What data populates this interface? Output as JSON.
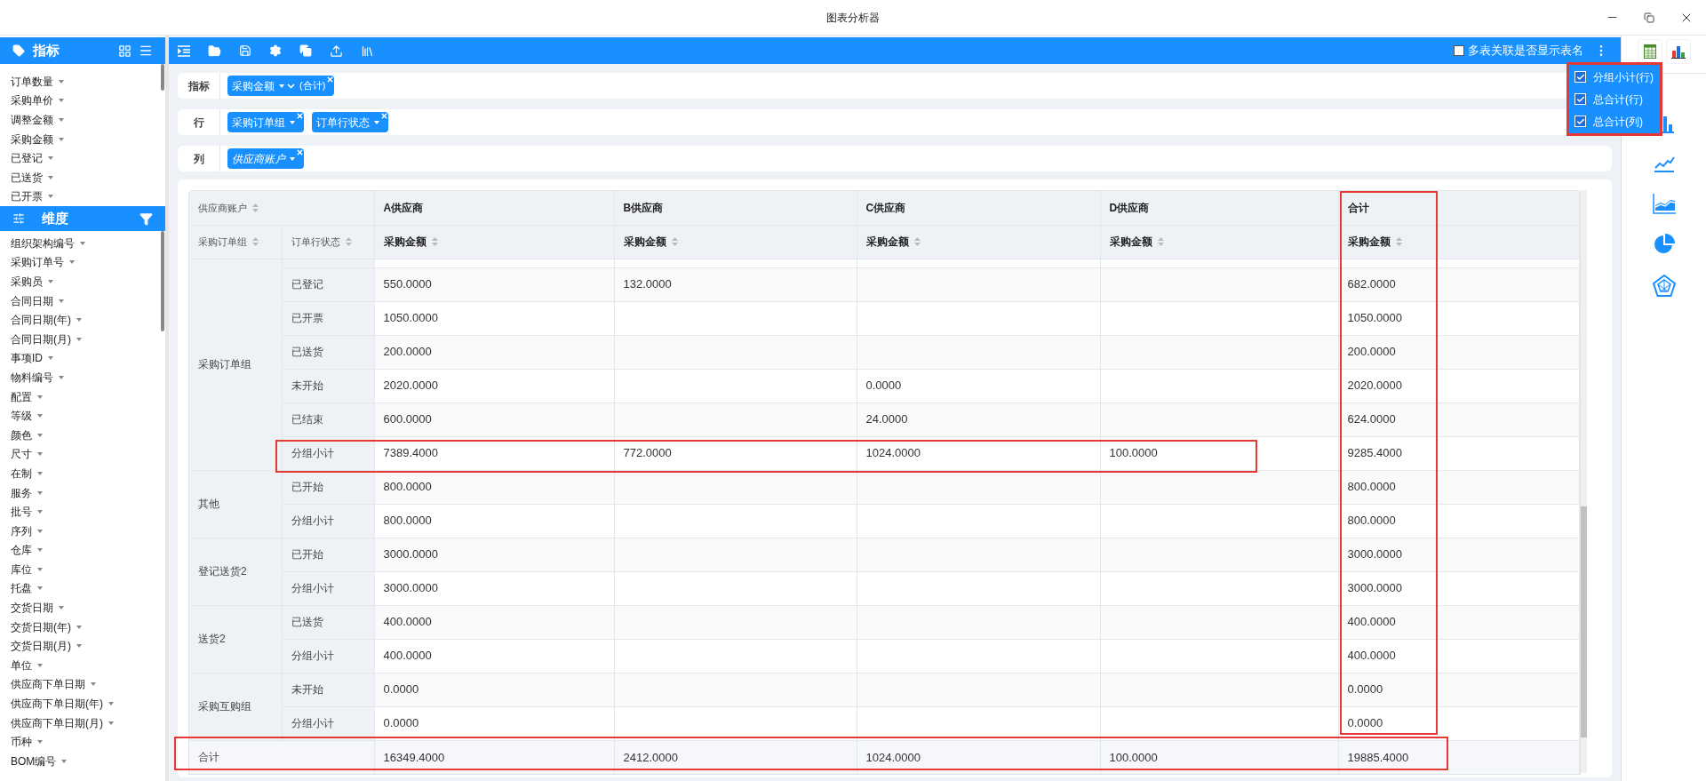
{
  "window": {
    "title": "图表分析器"
  },
  "metrics_panel": {
    "title": "指标",
    "items": [
      "订单数量",
      "采购单价",
      "调整金额",
      "采购金额",
      "已登记",
      "已送货",
      "已开票"
    ]
  },
  "dimensions_panel": {
    "title": "维度",
    "items": [
      "组织架构编号",
      "采购订单号",
      "采购员",
      "合同日期",
      "合同日期(年)",
      "合同日期(月)",
      "事项ID",
      "物料编号",
      "配置",
      "等级",
      "颜色",
      "尺寸",
      "在制",
      "服务",
      "批号",
      "序列",
      "仓库",
      "库位",
      "托盘",
      "交货日期",
      "交货日期(年)",
      "交货日期(月)",
      "单位",
      "供应商下单日期",
      "供应商下单日期(年)",
      "供应商下单日期(月)",
      "币种",
      "BOM编号"
    ]
  },
  "toolbar": {
    "option": {
      "label": "多表关联是否显示表名",
      "checked": false
    }
  },
  "totals_menu": [
    {
      "label": "分组小计(行)",
      "checked": true
    },
    {
      "label": "总合计(行)",
      "checked": true
    },
    {
      "label": "总合计(列)",
      "checked": true
    }
  ],
  "shelves": [
    {
      "label": "指标",
      "pills": [
        {
          "text": "采购金额",
          "suffix": "(合计)",
          "italic": false
        }
      ]
    },
    {
      "label": "行",
      "pills": [
        {
          "text": "采购订单组",
          "italic": false
        },
        {
          "text": "订单行状态",
          "italic": false
        }
      ]
    },
    {
      "label": "列",
      "pills": [
        {
          "text": "供应商账户",
          "italic": true
        }
      ]
    }
  ],
  "table": {
    "corner": "供应商账户",
    "columns": [
      "A供应商",
      "B供应商",
      "C供应商",
      "D供应商",
      "合计"
    ],
    "row_fields": [
      "采购订单组",
      "订单行状态"
    ],
    "measures": [
      "采购金额",
      "采购金额",
      "采购金额",
      "采购金额",
      "采购金额"
    ],
    "groups": [
      {
        "name": "采购订单组",
        "rows": [
          {
            "status": "已登记",
            "values": {
              "a": "550.0000",
              "b": "132.0000",
              "total": "682.0000"
            }
          },
          {
            "status": "已开票",
            "values": {
              "a": "1050.0000",
              "total": "1050.0000"
            }
          },
          {
            "status": "已送货",
            "values": {
              "a": "200.0000",
              "total": "200.0000"
            }
          },
          {
            "status": "未开始",
            "values": {
              "a": "2020.0000",
              "c": "0.0000",
              "total": "2020.0000"
            }
          },
          {
            "status": "已结束",
            "values": {
              "a": "600.0000",
              "c": "24.0000",
              "total": "624.0000"
            }
          },
          {
            "status": "分组小计",
            "values": {
              "a": "7389.4000",
              "b": "772.0000",
              "c": "1024.0000",
              "d": "100.0000",
              "total": "9285.4000"
            }
          }
        ]
      },
      {
        "name": "其他",
        "rows": [
          {
            "status": "已开始",
            "values": {
              "a": "800.0000",
              "total": "800.0000"
            }
          },
          {
            "status": "分组小计",
            "values": {
              "a": "800.0000",
              "total": "800.0000"
            }
          }
        ]
      },
      {
        "name": "登记送货2",
        "rows": [
          {
            "status": "已开始",
            "values": {
              "a": "3000.0000",
              "total": "3000.0000"
            }
          },
          {
            "status": "分组小计",
            "values": {
              "a": "3000.0000",
              "total": "3000.0000"
            }
          }
        ]
      },
      {
        "name": "送货2",
        "rows": [
          {
            "status": "已送货",
            "values": {
              "a": "400.0000",
              "total": "400.0000"
            }
          },
          {
            "status": "分组小计",
            "values": {
              "a": "400.0000",
              "total": "400.0000"
            }
          }
        ]
      },
      {
        "name": "采购互购组",
        "rows": [
          {
            "status": "未开始",
            "values": {
              "a": "0.0000",
              "total": "0.0000"
            }
          },
          {
            "status": "分组小计",
            "values": {
              "a": "0.0000",
              "total": "0.0000"
            }
          }
        ]
      }
    ],
    "grand_total": {
      "label": "合计",
      "values": {
        "a": "16349.4000",
        "b": "2412.0000",
        "c": "1024.0000",
        "d": "100.0000",
        "total": "19885.4000"
      }
    }
  }
}
